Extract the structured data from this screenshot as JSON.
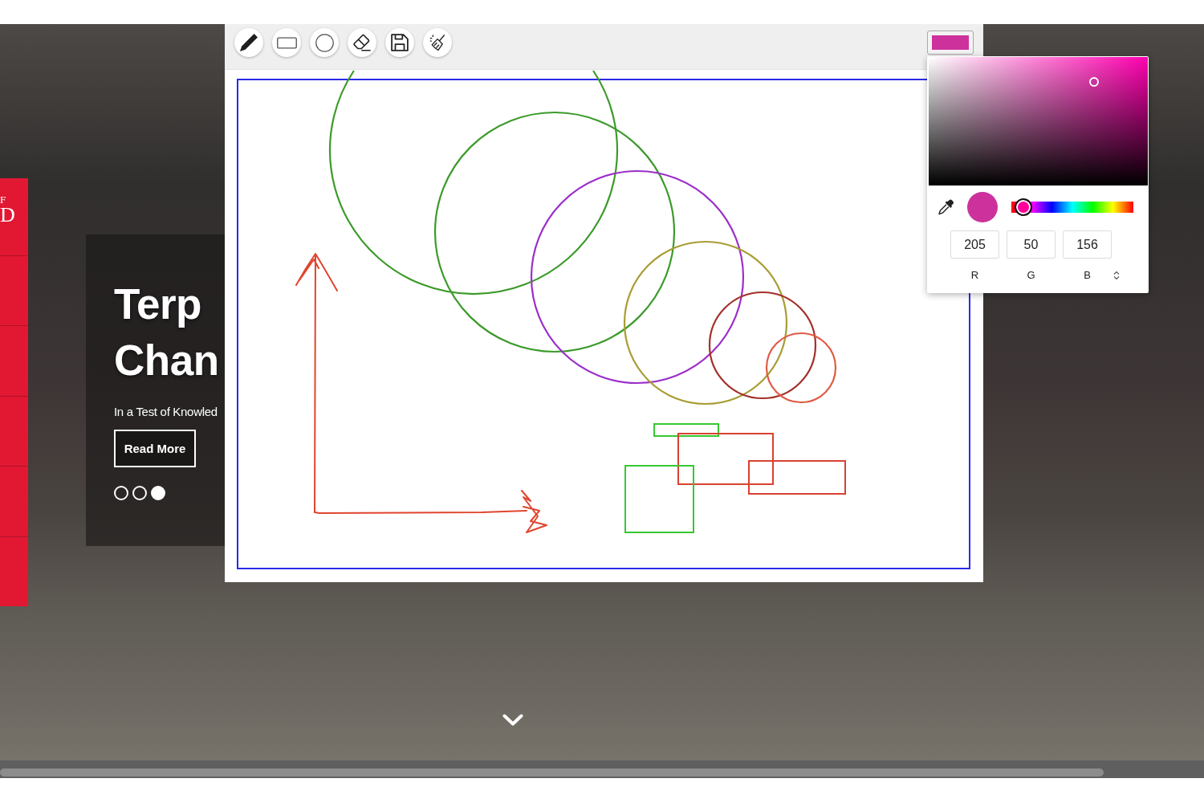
{
  "website": {
    "sidebar": {
      "logo_lines": [
        "F",
        "D"
      ]
    },
    "hero": {
      "title_lines": [
        "Terp",
        "Chan"
      ],
      "subtitle": "In a Test of Knowled",
      "button": "Read More",
      "slides": [
        {
          "selected": false
        },
        {
          "selected": false
        },
        {
          "selected": true
        }
      ]
    }
  },
  "whiteboard": {
    "tools": [
      {
        "kind": "pencil"
      },
      {
        "kind": "rectangle"
      },
      {
        "kind": "circle"
      },
      {
        "kind": "eraser"
      },
      {
        "kind": "save"
      },
      {
        "kind": "clear"
      }
    ],
    "color_swatch": {
      "color": "#cd329c"
    },
    "shapes": [
      {
        "kind": "circle",
        "color": "#3c9a2a"
      },
      {
        "kind": "circle",
        "color": "#3c9a2a"
      },
      {
        "kind": "circle",
        "color": "#9b2fc9"
      },
      {
        "kind": "circle",
        "color": "#a89c32"
      },
      {
        "kind": "circle",
        "color": "#a3302a"
      },
      {
        "kind": "circle",
        "color": "#e05a44"
      },
      {
        "kind": "rectangle",
        "color": "#36c832"
      },
      {
        "kind": "rectangle",
        "color": "#d9412f"
      },
      {
        "kind": "rectangle",
        "color": "#d9412f"
      },
      {
        "kind": "rectangle",
        "color": "#36c832"
      },
      {
        "kind": "stroke",
        "color": "#e0452f"
      },
      {
        "kind": "stroke",
        "color": "#e0452f"
      }
    ]
  },
  "color_picker": {
    "color": "#cd329c",
    "hue_slider": {
      "level": 0.1
    },
    "fields": [
      {
        "label": "R",
        "value": "205"
      },
      {
        "label": "G",
        "value": "50"
      },
      {
        "label": "B",
        "value": "156"
      }
    ]
  }
}
